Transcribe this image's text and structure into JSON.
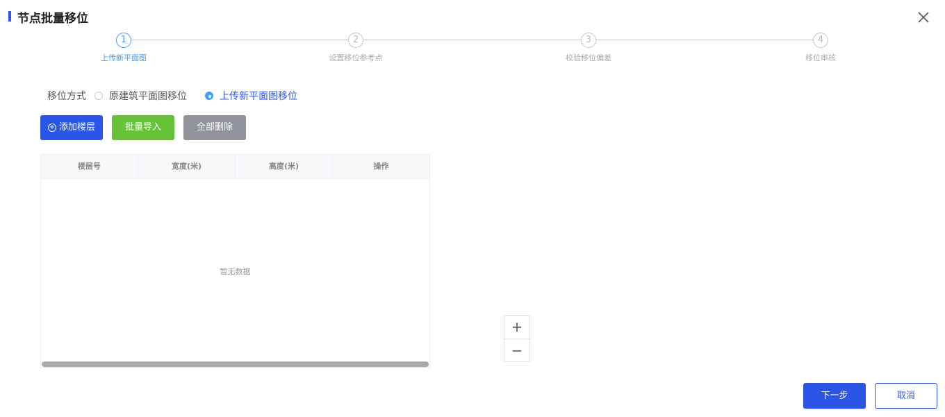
{
  "dialog": {
    "title": "节点批量移位"
  },
  "steps": [
    {
      "number": "1",
      "label": "上传新平面图",
      "state": "active"
    },
    {
      "number": "2",
      "label": "设置移位参考点",
      "state": "pending"
    },
    {
      "number": "3",
      "label": "校验移位偏差",
      "state": "pending"
    },
    {
      "number": "4",
      "label": "移位审核",
      "state": "pending"
    }
  ],
  "mode": {
    "label": "移位方式",
    "options": [
      {
        "label": "原建筑平面图移位",
        "checked": false
      },
      {
        "label": "上传新平面图移位",
        "checked": true
      }
    ]
  },
  "toolbar": {
    "add_floor": "添加楼层",
    "batch_import": "批量导入",
    "delete_all": "全部删除"
  },
  "table": {
    "columns": [
      "楼层号",
      "宽度(米)",
      "高度(米)",
      "操作"
    ],
    "rows": [],
    "empty_text": "暂无数据"
  },
  "zoom": {
    "in": "+",
    "out": "−"
  },
  "footer": {
    "next": "下一步",
    "cancel": "取消"
  },
  "colors": {
    "primary": "#2b55e6",
    "step_active": "#409eff",
    "success": "#67c23a",
    "gray_button": "#909399"
  },
  "icons": {
    "close": "close-icon",
    "add": "plus-circle-icon"
  }
}
